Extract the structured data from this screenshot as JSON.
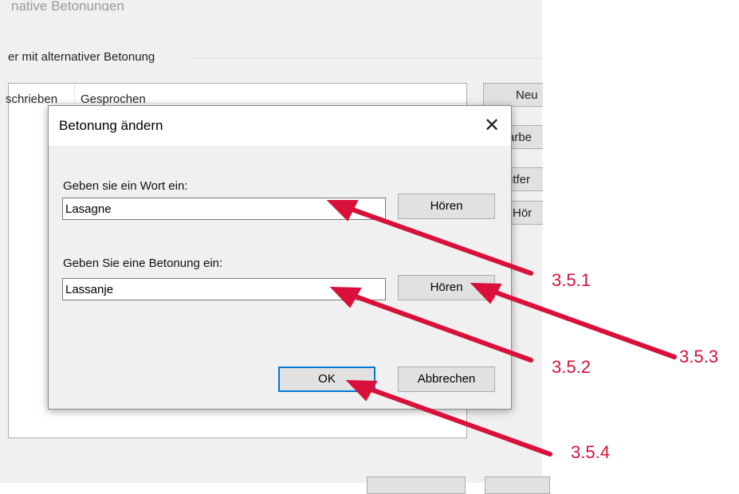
{
  "background_window": {
    "title": "native Betonungen",
    "group_label": "er mit alternativer Betonung",
    "columns": [
      "schrieben",
      "Gesprochen"
    ],
    "side_buttons": [
      "Neu",
      "arbe",
      "ntfer",
      "Hör"
    ]
  },
  "dialog": {
    "title": "Betonung ändern",
    "close_glyph": "✕",
    "word_label": "Geben sie ein Wort ein:",
    "word_value": "Lasagne",
    "hear_label_1": "Hören",
    "stress_label": "Geben Sie eine Betonung ein:",
    "stress_value": "Lassanje",
    "hear_label_2": "Hören",
    "ok_label": "OK",
    "cancel_label": "Abbrechen"
  },
  "annotations": {
    "color": "#d8103a",
    "labels": [
      "3.5.1",
      "3.5.2",
      "3.5.3",
      "3.5.4"
    ]
  }
}
